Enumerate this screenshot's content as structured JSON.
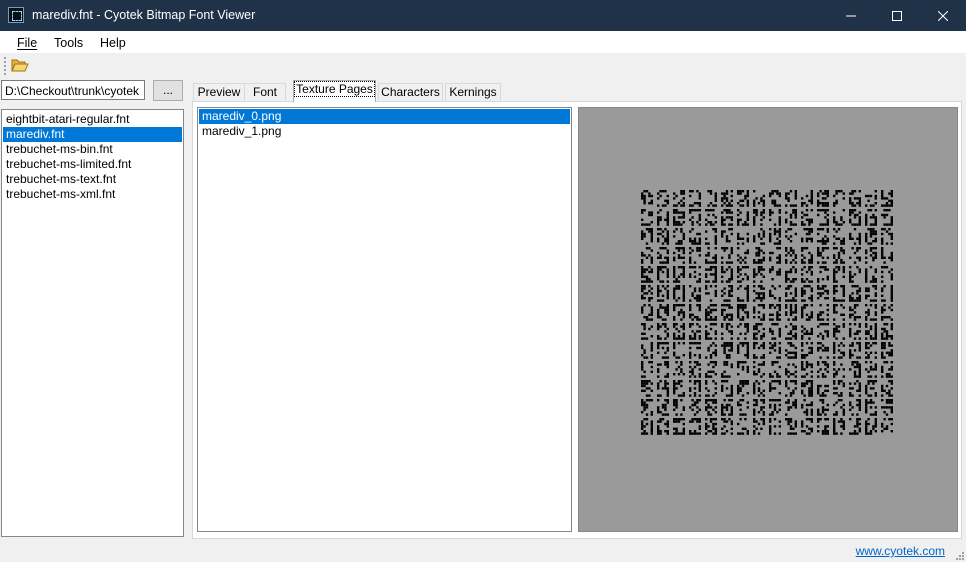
{
  "window": {
    "title": "marediv.fnt - Cyotek Bitmap Font Viewer"
  },
  "window_controls": {
    "minimize": "─",
    "maximize": "☐",
    "close": "✕"
  },
  "menu": {
    "items": [
      "File",
      "Tools",
      "Help"
    ]
  },
  "toolbar": {
    "open_icon": "folder-open-icon"
  },
  "path": {
    "value": "D:\\Checkout\\trunk\\cyotek"
  },
  "browse": {
    "label": "..."
  },
  "files": {
    "items": [
      "eightbit-atari-regular.fnt",
      "marediv.fnt",
      "trebuchet-ms-bin.fnt",
      "trebuchet-ms-limited.fnt",
      "trebuchet-ms-text.fnt",
      "trebuchet-ms-xml.fnt"
    ],
    "selected": 1
  },
  "tabs": {
    "items": [
      "Preview",
      "Font",
      "Texture Pages",
      "Characters",
      "Kernings"
    ],
    "active": 2
  },
  "texture_pages": {
    "items": [
      "marediv_0.png",
      "marediv_1.png"
    ],
    "selected": 0
  },
  "status": {
    "link": "www.cyotek.com"
  },
  "colors": {
    "titlebar": "#1f3247",
    "selection": "#0078d7",
    "preview_bg": "#9a9a9a",
    "link": "#0066cc"
  }
}
